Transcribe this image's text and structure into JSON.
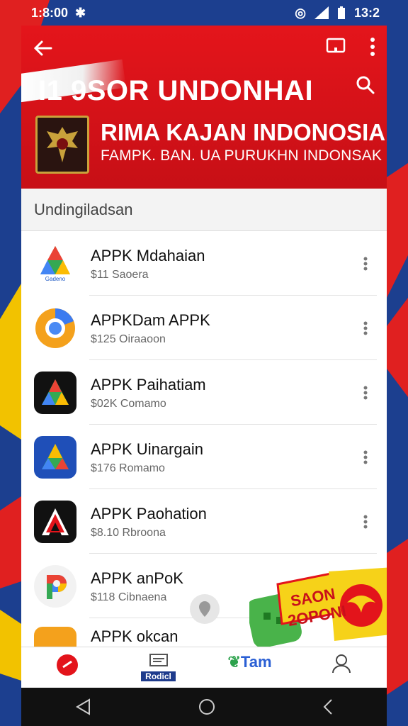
{
  "status_bar": {
    "time": "1:8:00",
    "battery_time": "13:2"
  },
  "header": {
    "app_title": "I1 9SOR UNDONHAI",
    "hero_title": "RIMA KAJAN INDONOSIAI",
    "hero_subtitle": "FAMPK. BAN. UA PURUKHN INDONSAK"
  },
  "section": {
    "label": "Undingiladsan"
  },
  "apps": [
    {
      "name": "APPK Mdahaian",
      "meta": "$11 Saoera",
      "icon": "google-drive-like-icon"
    },
    {
      "name": "APPKDam APPK",
      "meta": "$125 Oiraaoon",
      "icon": "chrome-like-icon"
    },
    {
      "name": "APPK Paihatiam",
      "meta": "$02K Comamo",
      "icon": "colorful-a-icon"
    },
    {
      "name": "APPK Uinargain",
      "meta": "$176 Romamo",
      "icon": "blue-a-icon"
    },
    {
      "name": "APPK Paohation",
      "meta": "$8.10 Rbroona",
      "icon": "black-a-icon"
    },
    {
      "name": "APPK anPoK",
      "meta": "$118 Cibnaena",
      "icon": "google-pay-like-icon"
    },
    {
      "name": "APPK okcan",
      "meta": "",
      "icon": "partial-app-icon"
    }
  ],
  "promo": {
    "line1": "SAON",
    "line2": "2OPONI"
  },
  "bottom_nav": [
    {
      "label": "",
      "icon": "home-icon"
    },
    {
      "label": "Rodicl",
      "icon": "library-icon"
    },
    {
      "label": "Tam",
      "icon": "brand-icon"
    },
    {
      "label": "",
      "icon": "account-icon"
    }
  ],
  "colors": {
    "header_red": "#e4151b",
    "bg_blue": "#1c3f8f",
    "nav_blue": "#1e3b8c"
  }
}
